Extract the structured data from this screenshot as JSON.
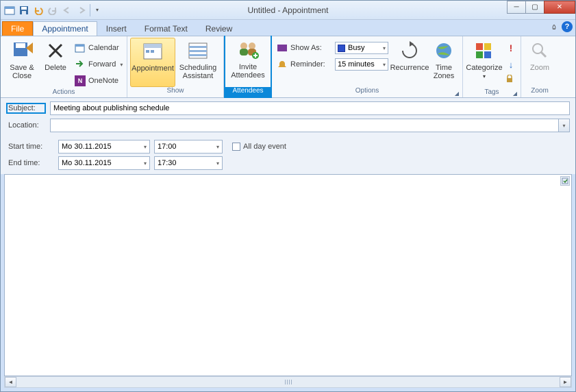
{
  "window": {
    "title": "Untitled  -  Appointment"
  },
  "qat": {},
  "tabs": {
    "file": "File",
    "appointment": "Appointment",
    "insert": "Insert",
    "format_text": "Format Text",
    "review": "Review"
  },
  "ribbon": {
    "groups": {
      "actions": {
        "label": "Actions",
        "save_close": "Save &\nClose",
        "delete": "Delete",
        "calendar": "Calendar",
        "forward": "Forward",
        "onenote": "OneNote"
      },
      "show": {
        "label": "Show",
        "appointment": "Appointment",
        "scheduling": "Scheduling\nAssistant"
      },
      "attendees": {
        "label": "Attendees",
        "invite": "Invite\nAttendees"
      },
      "options": {
        "label": "Options",
        "show_as_label": "Show As:",
        "show_as_value": "Busy",
        "reminder_label": "Reminder:",
        "reminder_value": "15 minutes",
        "recurrence": "Recurrence",
        "time_zones": "Time\nZones"
      },
      "tags": {
        "label": "Tags",
        "categorize": "Categorize"
      },
      "zoom": {
        "label": "Zoom",
        "zoom": "Zoom"
      }
    }
  },
  "form": {
    "subject_label": "Subject:",
    "subject_value": "Meeting about publishing schedule",
    "location_label": "Location:",
    "location_value": "",
    "start_label": "Start time:",
    "end_label": "End time:",
    "start_date": "Mo 30.11.2015",
    "start_time": "17:00",
    "end_date": "Mo 30.11.2015",
    "end_time": "17:30",
    "all_day": "All day event"
  }
}
